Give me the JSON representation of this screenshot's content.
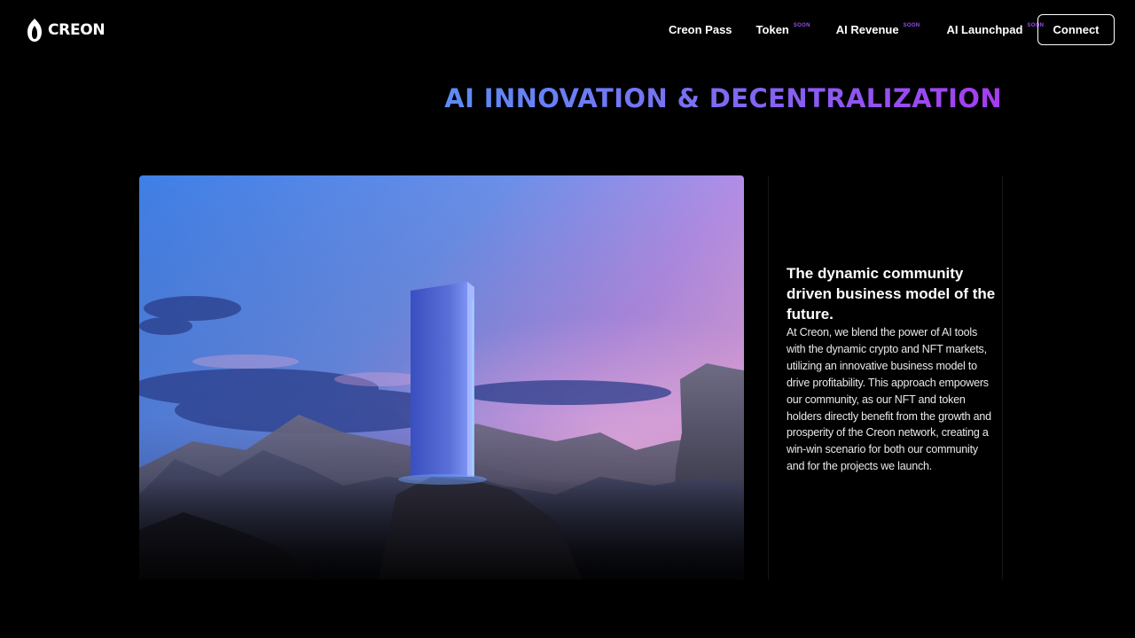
{
  "brand": {
    "name": "CREON",
    "logo_icon": "flame-icon"
  },
  "nav": {
    "items": [
      {
        "label": "Creon Pass",
        "badge": ""
      },
      {
        "label": "Token",
        "badge": "SOON"
      },
      {
        "label": "AI Revenue",
        "badge": "SOON"
      },
      {
        "label": "AI Launchpad",
        "badge": "SOON"
      }
    ],
    "connect_label": "Connect"
  },
  "hero": {
    "headline": "AI INNOVATION & DECENTRALIZATION",
    "image": "monolith-landscape-image"
  },
  "panel": {
    "title": "The dynamic community driven business model of the future.",
    "body": "At Creon, we blend the power of AI tools with the dynamic crypto and NFT markets, utilizing an innovative business model to drive profitability. This approach empowers our community, as our NFT and token holders directly benefit from the growth and prosperity of the Creon network, creating a win-win scenario for both our community and for the projects we launch."
  },
  "colors": {
    "background": "#000000",
    "accent_blue": "#5c8cf5",
    "accent_purple": "#a63cf0",
    "badge": "#9a4cf0"
  }
}
